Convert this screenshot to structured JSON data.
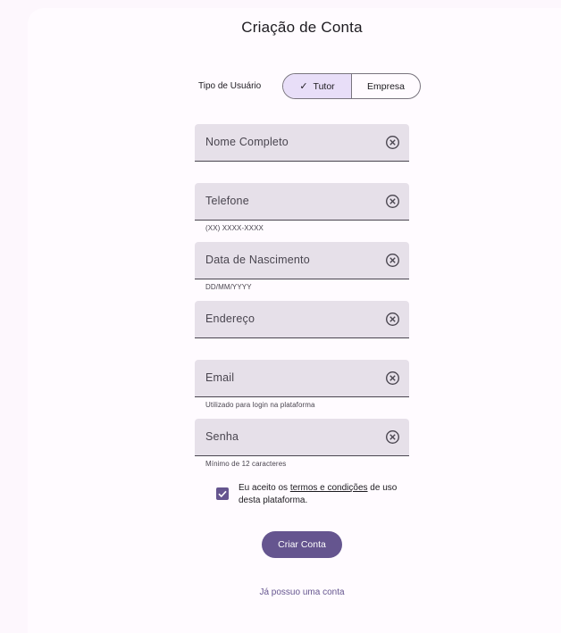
{
  "page": {
    "title": "Criação de Conta"
  },
  "user_type": {
    "label": "Tipo de Usuário",
    "options": [
      {
        "label": "Tutor",
        "selected": true
      },
      {
        "label": "Empresa",
        "selected": false
      }
    ]
  },
  "fields": [
    {
      "label": "Nome Completo",
      "supporting": "",
      "icon": "clear-circle-icon"
    },
    {
      "label": "Telefone",
      "supporting": "(XX) XXXX-XXXX",
      "icon": "clear-circle-icon"
    },
    {
      "label": "Data de Nascimento",
      "supporting": "DD/MM/YYYY",
      "icon": "clear-circle-icon"
    },
    {
      "label": "Endereço",
      "supporting": "",
      "icon": "clear-circle-icon"
    },
    {
      "label": "Email",
      "supporting": "Utilizado para login na plataforma",
      "icon": "clear-circle-icon"
    },
    {
      "label": "Senha",
      "supporting": "Mínimo de 12 caracteres",
      "icon": "clear-circle-icon"
    }
  ],
  "terms": {
    "checked": true,
    "prefix": "Eu aceito os ",
    "link": "termos e condições",
    "suffix": " de uso desta plataforma."
  },
  "actions": {
    "create_account": "Criar Conta",
    "have_account": "Já possuo uma conta"
  },
  "colors": {
    "primary": "#65558f",
    "field_bg": "#e6e0e9",
    "selected_segment": "#e8def8",
    "background": "#fdf7fd"
  }
}
